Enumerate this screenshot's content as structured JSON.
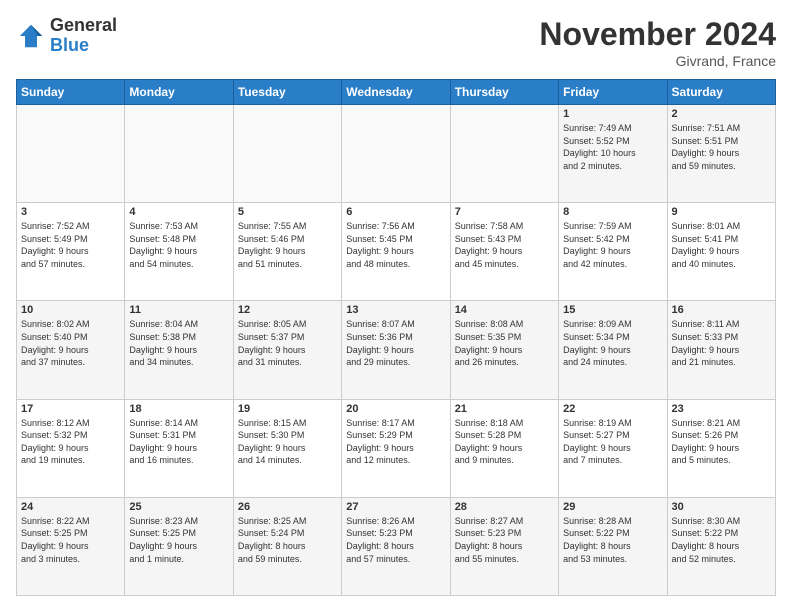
{
  "logo": {
    "line1": "General",
    "line2": "Blue"
  },
  "title": "November 2024",
  "location": "Givrand, France",
  "weekdays": [
    "Sunday",
    "Monday",
    "Tuesday",
    "Wednesday",
    "Thursday",
    "Friday",
    "Saturday"
  ],
  "weeks": [
    [
      {
        "day": "",
        "info": ""
      },
      {
        "day": "",
        "info": ""
      },
      {
        "day": "",
        "info": ""
      },
      {
        "day": "",
        "info": ""
      },
      {
        "day": "",
        "info": ""
      },
      {
        "day": "1",
        "info": "Sunrise: 7:49 AM\nSunset: 5:52 PM\nDaylight: 10 hours\nand 2 minutes."
      },
      {
        "day": "2",
        "info": "Sunrise: 7:51 AM\nSunset: 5:51 PM\nDaylight: 9 hours\nand 59 minutes."
      }
    ],
    [
      {
        "day": "3",
        "info": "Sunrise: 7:52 AM\nSunset: 5:49 PM\nDaylight: 9 hours\nand 57 minutes."
      },
      {
        "day": "4",
        "info": "Sunrise: 7:53 AM\nSunset: 5:48 PM\nDaylight: 9 hours\nand 54 minutes."
      },
      {
        "day": "5",
        "info": "Sunrise: 7:55 AM\nSunset: 5:46 PM\nDaylight: 9 hours\nand 51 minutes."
      },
      {
        "day": "6",
        "info": "Sunrise: 7:56 AM\nSunset: 5:45 PM\nDaylight: 9 hours\nand 48 minutes."
      },
      {
        "day": "7",
        "info": "Sunrise: 7:58 AM\nSunset: 5:43 PM\nDaylight: 9 hours\nand 45 minutes."
      },
      {
        "day": "8",
        "info": "Sunrise: 7:59 AM\nSunset: 5:42 PM\nDaylight: 9 hours\nand 42 minutes."
      },
      {
        "day": "9",
        "info": "Sunrise: 8:01 AM\nSunset: 5:41 PM\nDaylight: 9 hours\nand 40 minutes."
      }
    ],
    [
      {
        "day": "10",
        "info": "Sunrise: 8:02 AM\nSunset: 5:40 PM\nDaylight: 9 hours\nand 37 minutes."
      },
      {
        "day": "11",
        "info": "Sunrise: 8:04 AM\nSunset: 5:38 PM\nDaylight: 9 hours\nand 34 minutes."
      },
      {
        "day": "12",
        "info": "Sunrise: 8:05 AM\nSunset: 5:37 PM\nDaylight: 9 hours\nand 31 minutes."
      },
      {
        "day": "13",
        "info": "Sunrise: 8:07 AM\nSunset: 5:36 PM\nDaylight: 9 hours\nand 29 minutes."
      },
      {
        "day": "14",
        "info": "Sunrise: 8:08 AM\nSunset: 5:35 PM\nDaylight: 9 hours\nand 26 minutes."
      },
      {
        "day": "15",
        "info": "Sunrise: 8:09 AM\nSunset: 5:34 PM\nDaylight: 9 hours\nand 24 minutes."
      },
      {
        "day": "16",
        "info": "Sunrise: 8:11 AM\nSunset: 5:33 PM\nDaylight: 9 hours\nand 21 minutes."
      }
    ],
    [
      {
        "day": "17",
        "info": "Sunrise: 8:12 AM\nSunset: 5:32 PM\nDaylight: 9 hours\nand 19 minutes."
      },
      {
        "day": "18",
        "info": "Sunrise: 8:14 AM\nSunset: 5:31 PM\nDaylight: 9 hours\nand 16 minutes."
      },
      {
        "day": "19",
        "info": "Sunrise: 8:15 AM\nSunset: 5:30 PM\nDaylight: 9 hours\nand 14 minutes."
      },
      {
        "day": "20",
        "info": "Sunrise: 8:17 AM\nSunset: 5:29 PM\nDaylight: 9 hours\nand 12 minutes."
      },
      {
        "day": "21",
        "info": "Sunrise: 8:18 AM\nSunset: 5:28 PM\nDaylight: 9 hours\nand 9 minutes."
      },
      {
        "day": "22",
        "info": "Sunrise: 8:19 AM\nSunset: 5:27 PM\nDaylight: 9 hours\nand 7 minutes."
      },
      {
        "day": "23",
        "info": "Sunrise: 8:21 AM\nSunset: 5:26 PM\nDaylight: 9 hours\nand 5 minutes."
      }
    ],
    [
      {
        "day": "24",
        "info": "Sunrise: 8:22 AM\nSunset: 5:25 PM\nDaylight: 9 hours\nand 3 minutes."
      },
      {
        "day": "25",
        "info": "Sunrise: 8:23 AM\nSunset: 5:25 PM\nDaylight: 9 hours\nand 1 minute."
      },
      {
        "day": "26",
        "info": "Sunrise: 8:25 AM\nSunset: 5:24 PM\nDaylight: 8 hours\nand 59 minutes."
      },
      {
        "day": "27",
        "info": "Sunrise: 8:26 AM\nSunset: 5:23 PM\nDaylight: 8 hours\nand 57 minutes."
      },
      {
        "day": "28",
        "info": "Sunrise: 8:27 AM\nSunset: 5:23 PM\nDaylight: 8 hours\nand 55 minutes."
      },
      {
        "day": "29",
        "info": "Sunrise: 8:28 AM\nSunset: 5:22 PM\nDaylight: 8 hours\nand 53 minutes."
      },
      {
        "day": "30",
        "info": "Sunrise: 8:30 AM\nSunset: 5:22 PM\nDaylight: 8 hours\nand 52 minutes."
      }
    ]
  ]
}
